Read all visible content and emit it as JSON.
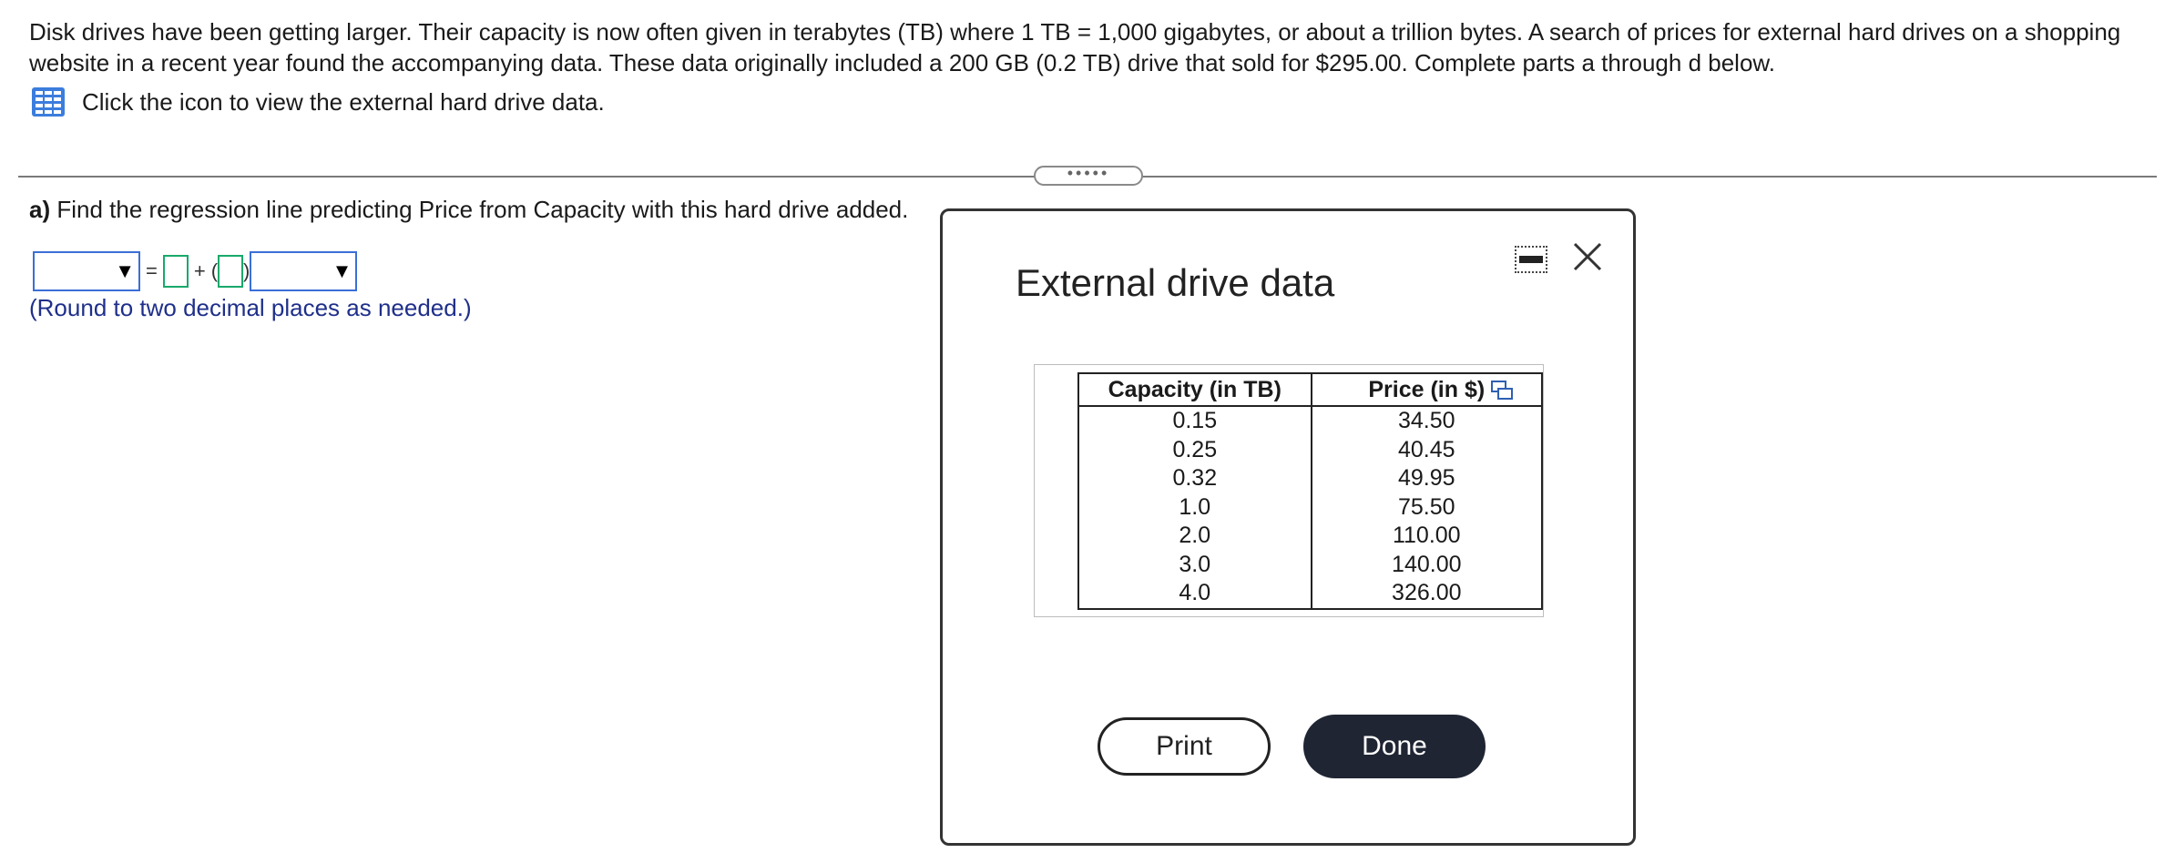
{
  "intro": {
    "text": "Disk drives have been getting larger. Their capacity is now often given in terabytes (TB) where 1 TB = 1,000 gigabytes, or about a trillion bytes. A search of prices for external hard drives on a shopping website in a recent year found the accompanying data. These data originally included a 200 GB (0.2 TB) drive that sold for $295.00. Complete parts a through d below.",
    "data_link_label": "Click the icon to view the external hard drive data."
  },
  "divider": {
    "handle_label": "•••••"
  },
  "part_a": {
    "label": "a)",
    "question": "Find the regression line predicting Price from Capacity with this hard drive added.",
    "equals": "=",
    "plus": "+",
    "paren_open": "(",
    "paren_close": ")",
    "round_note": "(Round to two decimal places as needed.)"
  },
  "modal": {
    "title": "External drive data",
    "table": {
      "headers": [
        "Capacity (in TB)",
        "Price (in $)"
      ],
      "rows": [
        [
          "0.15",
          "34.50"
        ],
        [
          "0.25",
          "40.45"
        ],
        [
          "0.32",
          "49.95"
        ],
        [
          "1.0",
          "75.50"
        ],
        [
          "2.0",
          "110.00"
        ],
        [
          "3.0",
          "140.00"
        ],
        [
          "4.0",
          "326.00"
        ]
      ]
    },
    "print_label": "Print",
    "done_label": "Done"
  },
  "icons": {
    "data_table": "table-grid-icon",
    "copy": "copy-icon",
    "minimize": "minimize-icon",
    "close": "close-icon",
    "dropdown": "dropdown-arrow-icon"
  },
  "colors": {
    "input_border": "#3b6fd6",
    "answer_box_border": "#19a96b",
    "note_text": "#1f2f8a",
    "done_button_bg": "#1f2533"
  }
}
